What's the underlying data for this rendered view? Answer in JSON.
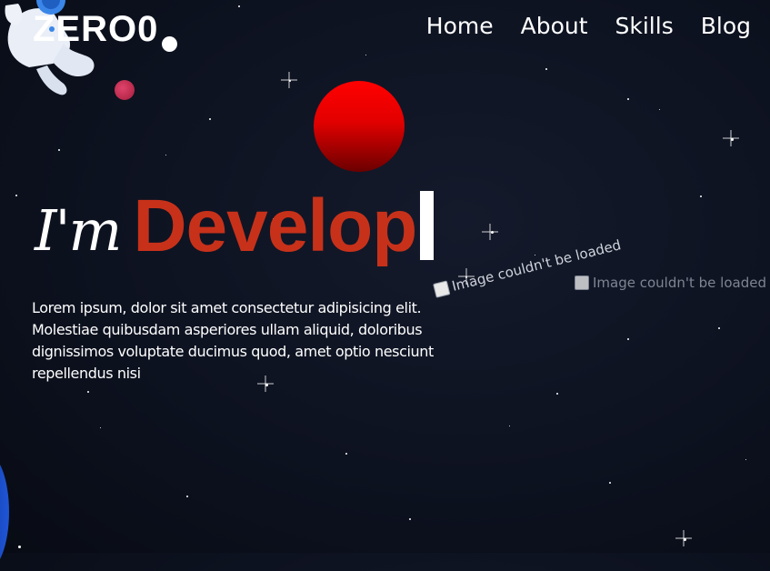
{
  "brand": {
    "logo_text": "ZERO0"
  },
  "nav": {
    "items": [
      "Home",
      "About",
      "Skills",
      "Blog"
    ]
  },
  "hero": {
    "prefix": "I'm",
    "typed_word": "Develop",
    "intro": "Lorem ipsum, dolor sit amet consectetur adipisicing elit. Molestiae quibusdam asperiores ullam aliquid, doloribus dignissimos voluptate ducimus quod, amet optio nesciunt repellendus nisi"
  },
  "broken_images": {
    "alt_1": "Image couldn't be loaded",
    "alt_2": "Image couldn't be loaded"
  },
  "colors": {
    "accent": "#c7311a",
    "sun": "#ff0000",
    "background": "#0d1220"
  },
  "icons": [
    "astronaut-icon",
    "broken-image-icon"
  ]
}
